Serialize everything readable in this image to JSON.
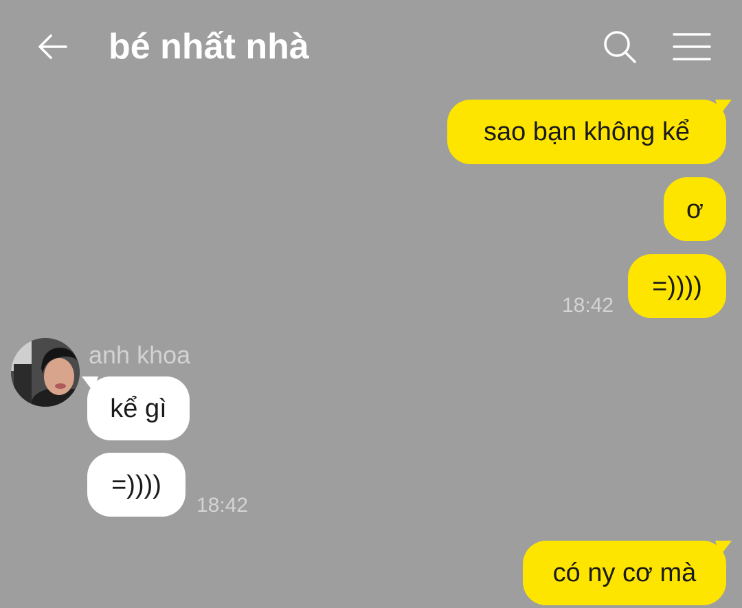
{
  "header": {
    "title": "bé nhất nhà",
    "back_icon": "arrow-left-icon",
    "search_icon": "search-icon",
    "menu_icon": "hamburger-menu-icon",
    "icon_color": "#ffffff"
  },
  "colors": {
    "background": "#9e9e9e",
    "outgoing_bubble": "#fee500",
    "incoming_bubble": "#ffffff"
  },
  "messages": {
    "out1": "sao bạn không kể",
    "out2": "ơ",
    "out3": "=))))",
    "out_time": "18:42",
    "sender_name": "anh khoa",
    "in1": "kể gì",
    "in2": "=))))",
    "in_time": "18:42",
    "out4": "có ny cơ mà"
  }
}
